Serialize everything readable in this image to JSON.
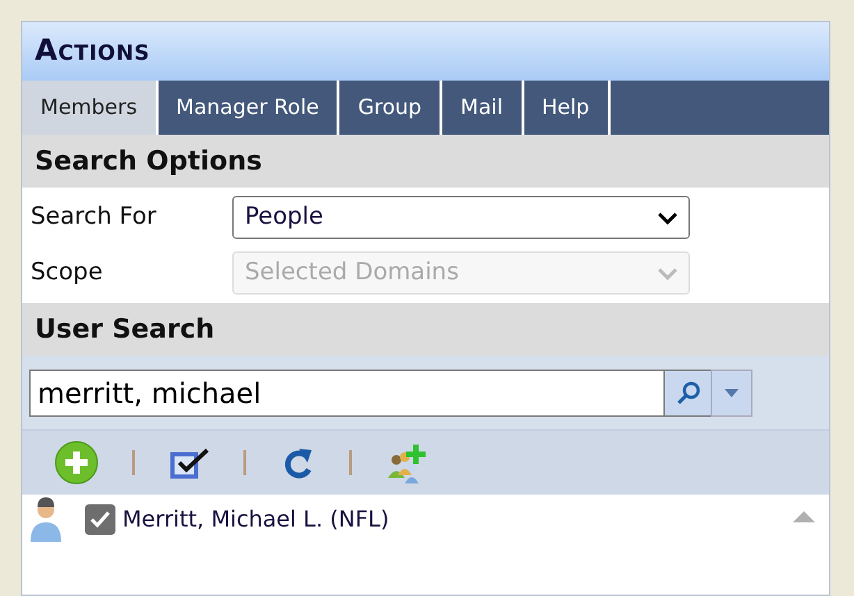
{
  "title": "Actions",
  "tabs": [
    {
      "label": "Members",
      "selected": true
    },
    {
      "label": "Manager Role",
      "selected": false
    },
    {
      "label": "Group",
      "selected": false
    },
    {
      "label": "Mail",
      "selected": false
    },
    {
      "label": "Help",
      "selected": false
    }
  ],
  "search_options": {
    "heading": "Search Options",
    "fields": [
      {
        "label": "Search For",
        "value": "People",
        "disabled": false
      },
      {
        "label": "Scope",
        "value": "Selected Domains",
        "disabled": true
      }
    ]
  },
  "user_search": {
    "heading": "User Search",
    "value": "merritt, michael"
  },
  "results": [
    {
      "name": "Merritt, Michael L. (NFL)",
      "checked": true
    }
  ]
}
